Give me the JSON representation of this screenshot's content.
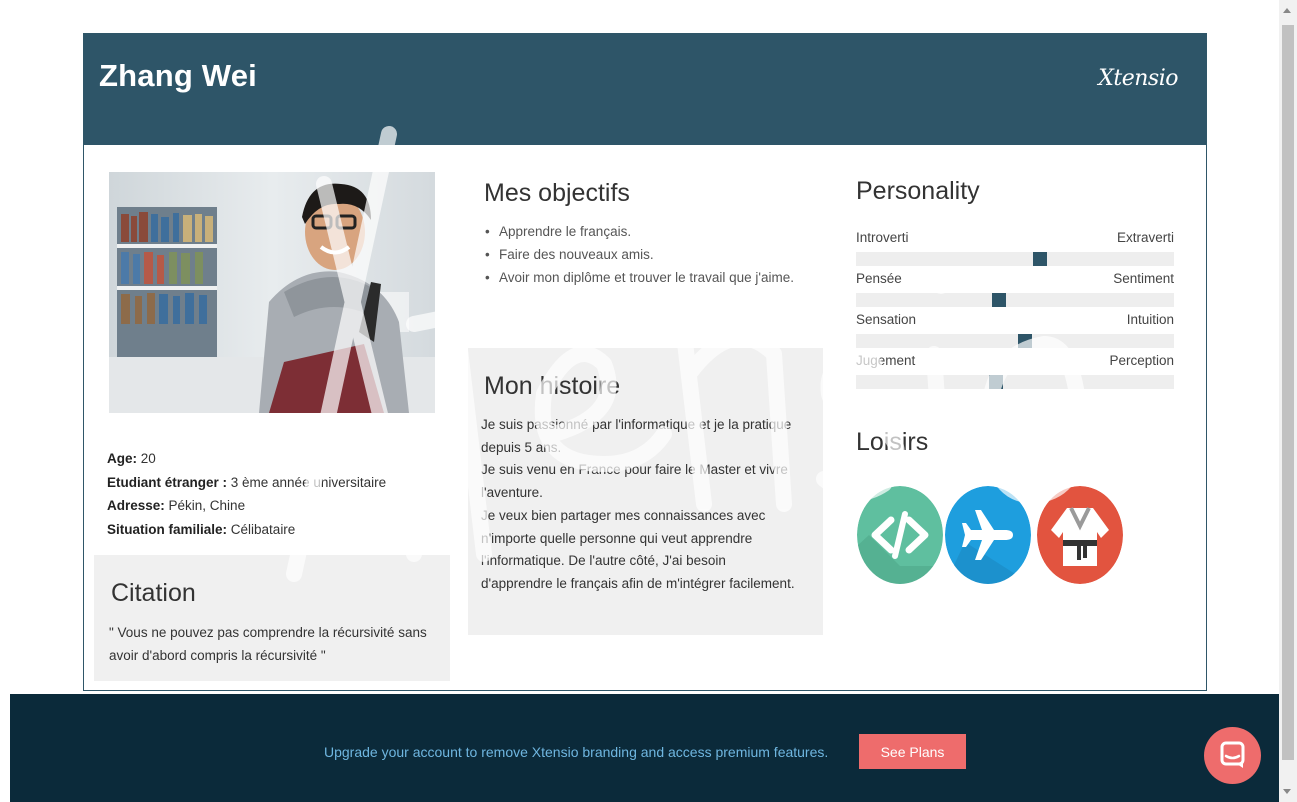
{
  "header": {
    "name": "Zhang Wei",
    "brand": "Xtensio"
  },
  "details": [
    {
      "label": "Age:",
      "value": " 20"
    },
    {
      "label": "Etudiant étranger :",
      "value": " 3 ème année universitaire"
    },
    {
      "label": "Adresse:",
      "value": " Pékin, Chine"
    },
    {
      "label": "Situation familiale:",
      "value": " Célibataire"
    }
  ],
  "citation": {
    "title": "Citation",
    "text": "\" Vous ne pouvez pas comprendre la récursivité sans avoir d'abord compris la récursivité \""
  },
  "goals": {
    "title": "Mes objectifs",
    "items": [
      "Apprendre le français.",
      "Faire des nouveaux amis.",
      "Avoir mon diplôme et trouver le travail que j'aime."
    ]
  },
  "story": {
    "title": "Mon histoire",
    "lines": [
      "Je suis passionné par l'informatique et je la pratique depuis 5 ans.",
      "Je suis venu en France pour faire le Master et vivre l'aventure.",
      "Je veux bien partager mes connaissances avec n'importe quelle personne qui veut apprendre l'informatique. De l'autre côté, J'ai besoin d'apprendre le français afin de m'intégrer facilement."
    ]
  },
  "personality": {
    "title": "Personality",
    "traits": [
      {
        "left": "Introverti",
        "right": "Extraverti",
        "level": 0.58
      },
      {
        "left": "Pensée",
        "right": "Sentiment",
        "level": 0.45
      },
      {
        "left": "Sensation",
        "right": "Intuition",
        "level": 0.53
      },
      {
        "left": "Jugement",
        "right": "Perception",
        "level": 0.44
      }
    ]
  },
  "hobbies": {
    "title": "Loisirs",
    "items": [
      {
        "icon": "code-icon",
        "color": "#5fbf9f"
      },
      {
        "icon": "airplane-icon",
        "color": "#1e9ede"
      },
      {
        "icon": "judo-gi-icon",
        "color": "#e2543f"
      }
    ]
  },
  "footer": {
    "text": "Upgrade your account to remove Xtensio branding and access premium features.",
    "button": "See Plans"
  },
  "colors": {
    "header": "#2e5568",
    "footer": "#0b2a3a",
    "accent": "#ee6c6c",
    "link": "#6fb6e0"
  }
}
